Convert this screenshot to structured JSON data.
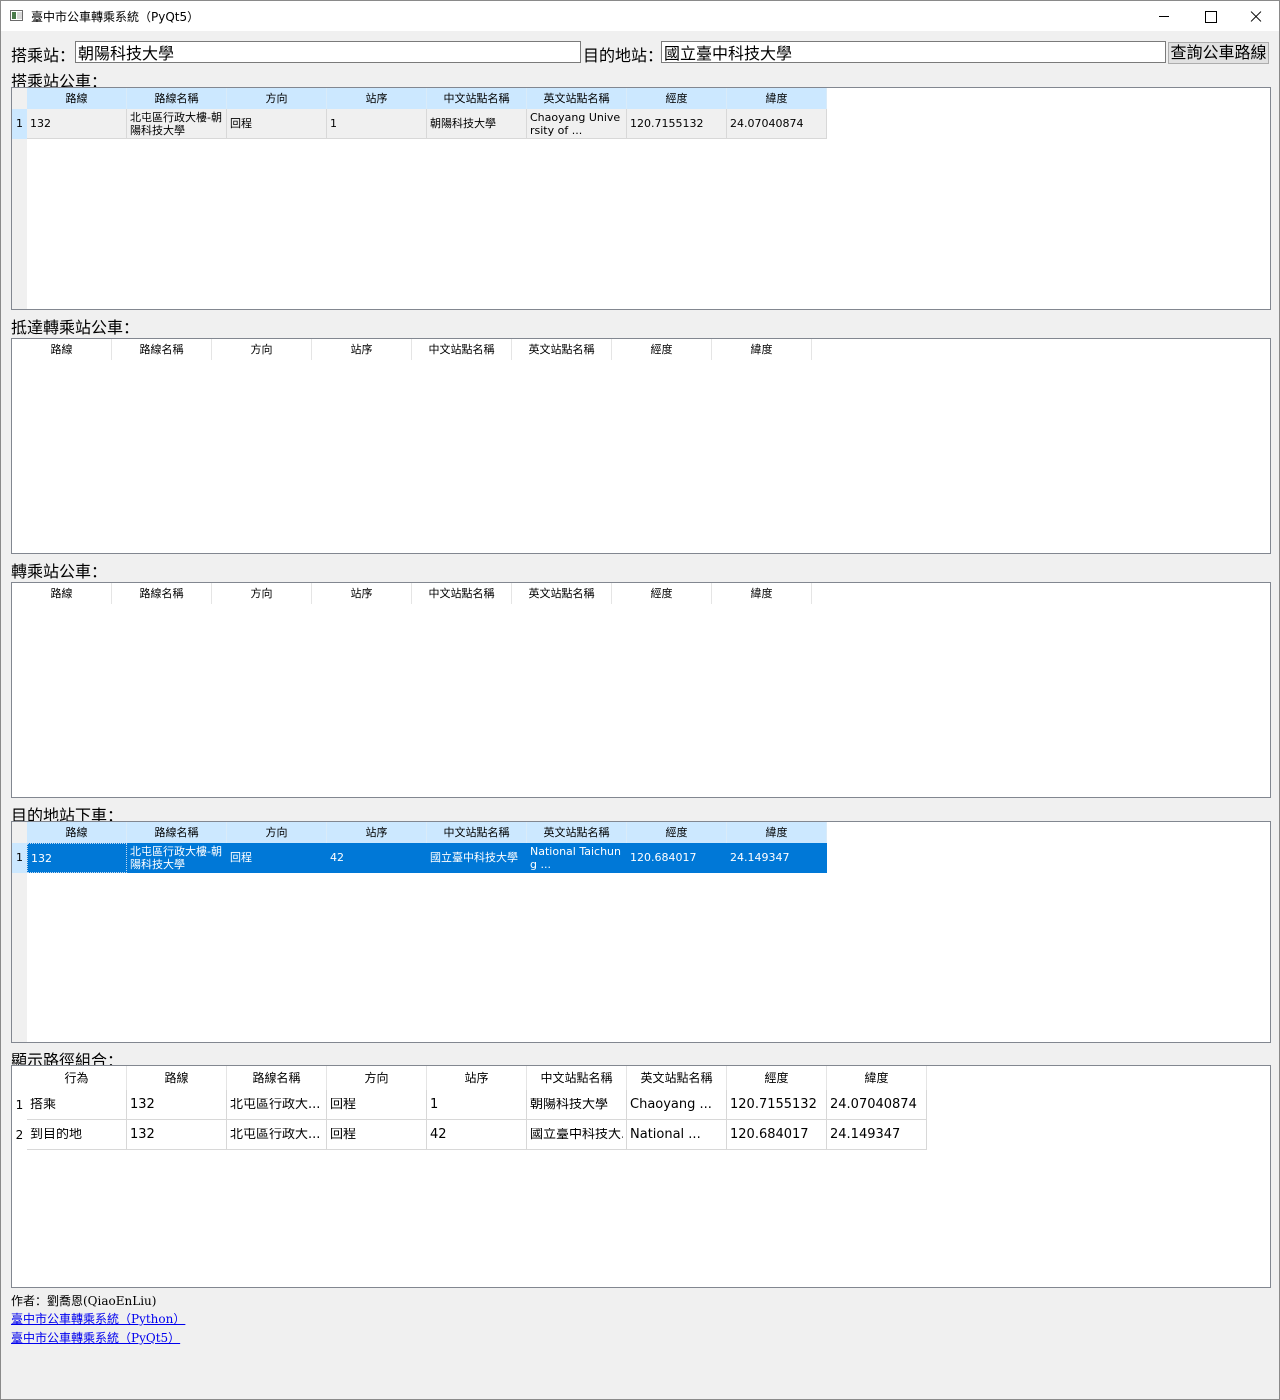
{
  "window": {
    "title": "臺中市公車轉乘系統（PyQt5）"
  },
  "query": {
    "boarding_label": "搭乘站：",
    "boarding_value": "朝陽科技大學",
    "destination_label": "目的地站：",
    "destination_value": "國立臺中科技大學",
    "search_button": "查詢公車路線"
  },
  "columns": [
    "路線",
    "路線名稱",
    "方向",
    "站序",
    "中文站點名稱",
    "英文站點名稱",
    "經度",
    "緯度"
  ],
  "boarding_table": {
    "label": "搭乘站公車：",
    "rows": [
      {
        "num": "1",
        "cells": [
          "132",
          "北屯區行政大樓-朝陽科技大學",
          "回程",
          "1",
          "朝陽科技大學",
          "Chaoyang University of ...",
          "120.7155132",
          "24.07040874"
        ]
      }
    ]
  },
  "arrive_transfer_table": {
    "label": "抵達轉乘站公車：",
    "rows": []
  },
  "transfer_table": {
    "label": "轉乘站公車：",
    "rows": []
  },
  "destination_table": {
    "label": "目的地站下車：",
    "rows": [
      {
        "num": "1",
        "cells": [
          "132",
          "北屯區行政大樓-朝陽科技大學",
          "回程",
          "42",
          "國立臺中科技大學",
          "National Taichung ...",
          "120.684017",
          "24.149347"
        ]
      }
    ]
  },
  "route_table": {
    "label": "顯示路徑組合：",
    "columns": [
      "行為",
      "路線",
      "路線名稱",
      "方向",
      "站序",
      "中文站點名稱",
      "英文站點名稱",
      "經度",
      "緯度"
    ],
    "rows": [
      {
        "num": "1",
        "cells": [
          "搭乘",
          "132",
          "北屯區行政大...",
          "回程",
          "1",
          "朝陽科技大學",
          "Chaoyang ...",
          "120.7155132",
          "24.07040874"
        ]
      },
      {
        "num": "2",
        "cells": [
          "到目的地",
          "132",
          "北屯區行政大...",
          "回程",
          "42",
          "國立臺中科技大...",
          "National ...",
          "120.684017",
          "24.149347"
        ]
      }
    ]
  },
  "footer": {
    "author": "作者：劉喬恩(QiaoEnLiu)",
    "link1": "臺中市公車轉乘系統（Python）",
    "link2": "臺中市公車轉乘系統（PyQt5）"
  }
}
